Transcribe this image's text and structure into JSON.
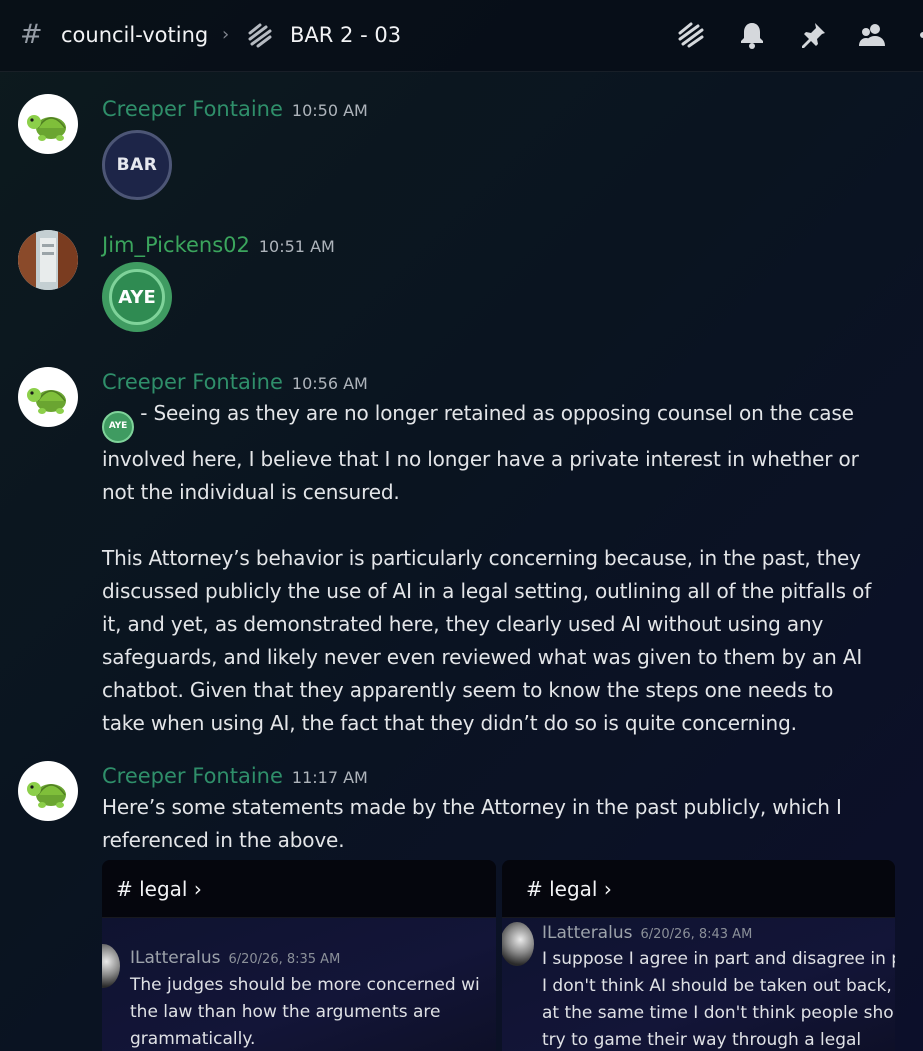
{
  "header": {
    "channel_hash": "#",
    "channel_name": "council-voting",
    "separator": "›",
    "thread_name": "BAR 2 - 03",
    "icons": [
      "threads-icon",
      "bell-icon",
      "pin-icon",
      "members-icon"
    ]
  },
  "messages": [
    {
      "username": "Creeper Fontaine",
      "user_color": "#3ba55d",
      "timestamp": "10:50 AM",
      "avatar": "turtle-avatar",
      "emoji": "BAR"
    },
    {
      "username": "Jim_Pickens02",
      "user_color": "#3ba55d",
      "timestamp": "10:51 AM",
      "avatar": "photo-avatar",
      "emoji": "AYE"
    },
    {
      "username": "Creeper Fontaine",
      "user_color": "#3ba55d",
      "timestamp": "10:56 AM",
      "avatar": "turtle-avatar",
      "inline_emoji": "AYE",
      "lines": [
        " - Seeing as they are no longer retained as opposing counsel on the case",
        "involved here, I believe that I no longer have a private interest in whether or",
        "not the individual is censured.",
        "",
        "This Attorney’s behavior is particularly concerning because, in the past, they",
        "discussed publicly the use of AI in a legal setting, outlining all of the pitfalls of",
        "it, and yet, as demonstrated here, they clearly used AI without using any",
        "safeguards, and likely never even reviewed what was given to them by an AI",
        "chatbot. Given that they apparently seem to know the steps one needs to",
        "take when using AI, the fact that they didn’t do so is quite concerning."
      ]
    },
    {
      "username": "Creeper Fontaine",
      "user_color": "#3ba55d",
      "timestamp": "11:17 AM",
      "avatar": "turtle-avatar",
      "lines": [
        "Here’s some statements made by the Attorney in the past publicly, which I",
        "referenced in the above."
      ]
    }
  ],
  "embeds": [
    {
      "channel": "# legal ›",
      "username": "ILatteralus",
      "timestamp": "6/20/26, 8:35 AM",
      "lines": [
        "The judges should be more concerned wi",
        "the law than how the arguments are",
        "grammatically."
      ]
    },
    {
      "channel": "# legal ›",
      "username": "ILatteralus",
      "timestamp": "6/20/26, 8:43 AM",
      "lines": [
        "I suppose I agree in part and disagree in pa",
        "I don't think AI should be taken out back, a",
        "at the same time I don't think people shoul",
        "try to game their way through a legal"
      ]
    }
  ]
}
